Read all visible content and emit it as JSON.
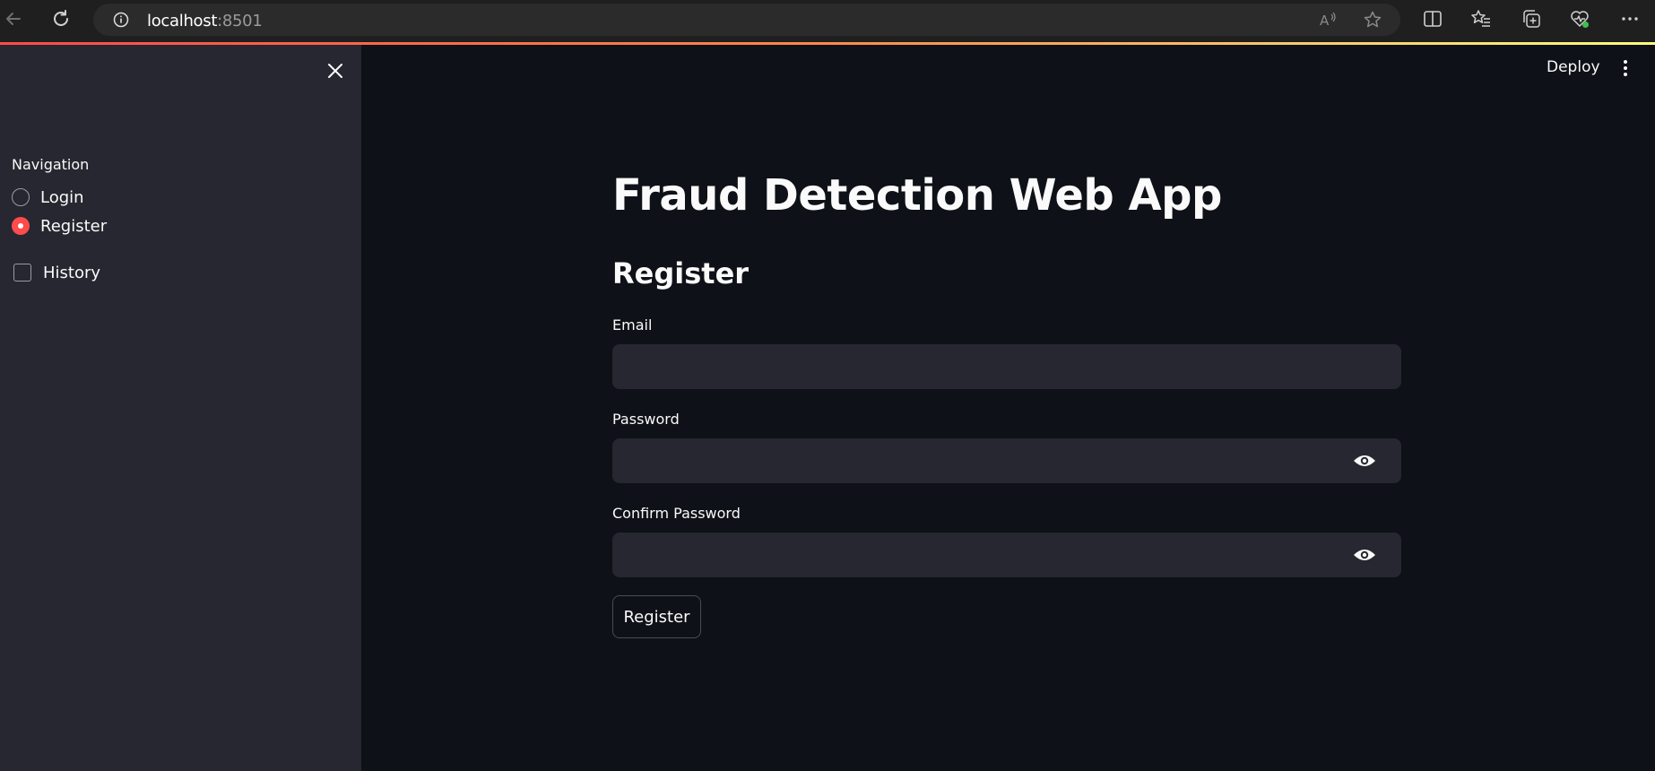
{
  "browser": {
    "url_host": "localhost",
    "url_port": ":8501"
  },
  "sidebar": {
    "heading": "Navigation",
    "radio_options": [
      {
        "label": "Login",
        "selected": false
      },
      {
        "label": "Register",
        "selected": true
      }
    ],
    "history_checkbox": {
      "label": "History",
      "checked": false
    }
  },
  "header": {
    "deploy_label": "Deploy"
  },
  "main": {
    "title": "Fraud Detection Web App",
    "subtitle": "Register",
    "fields": {
      "email_label": "Email",
      "email_value": "",
      "password_label": "Password",
      "password_value": "",
      "confirm_label": "Confirm Password",
      "confirm_value": ""
    },
    "submit_label": "Register"
  },
  "colors": {
    "accent": "#ff4b4b",
    "app_bg": "#0e1117",
    "sidebar_bg": "#262730",
    "input_bg": "#262730",
    "text": "#fafafa"
  }
}
